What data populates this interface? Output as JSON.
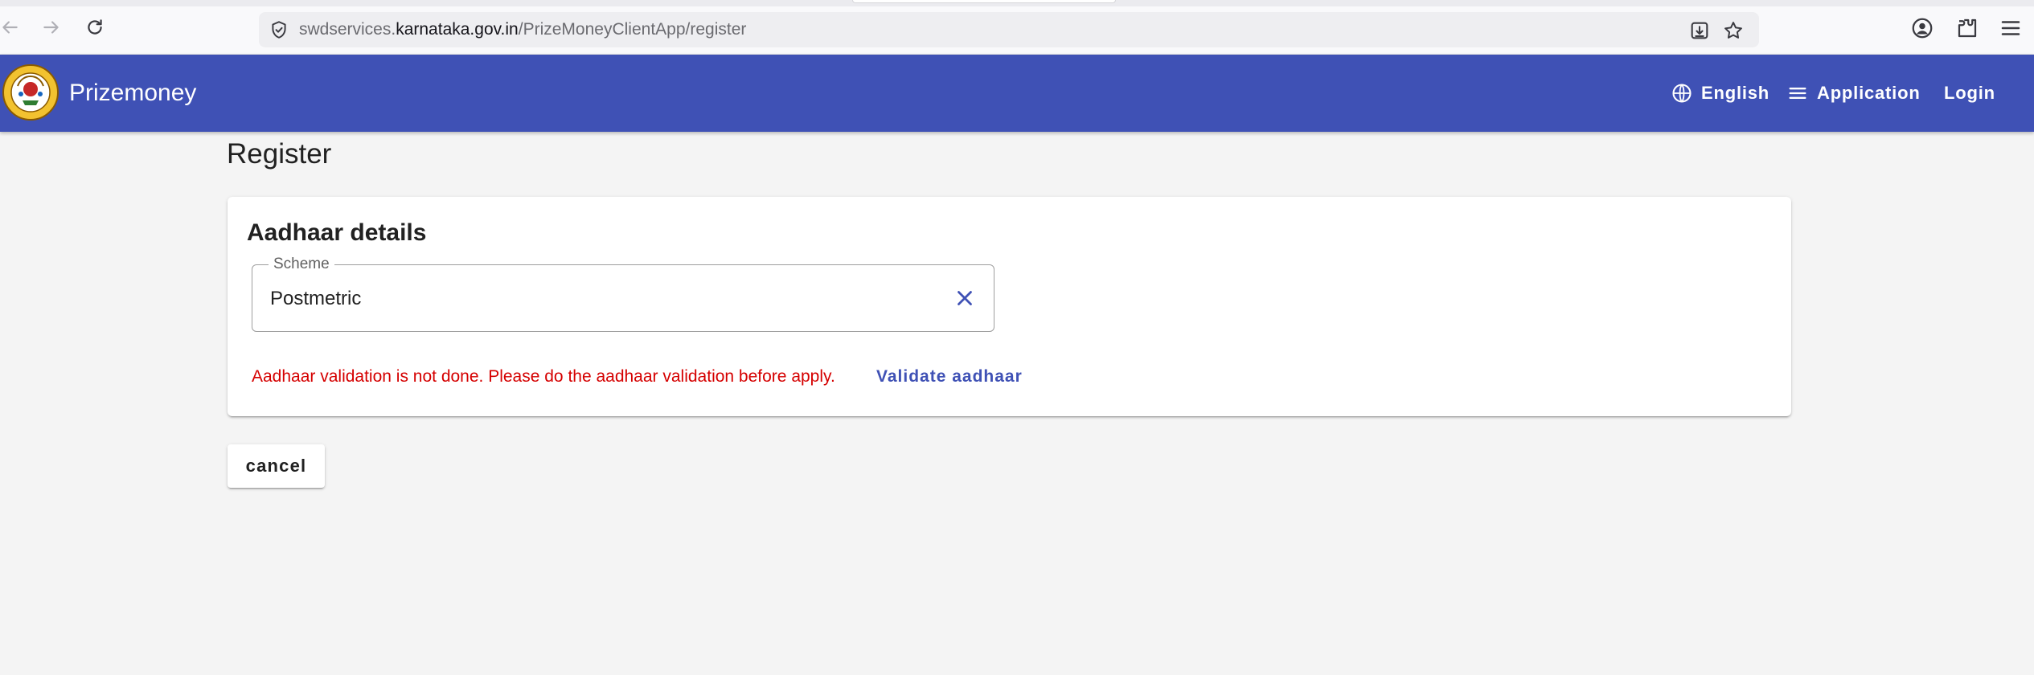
{
  "browser": {
    "url_prefix": "swdservices.",
    "url_domain": "karnataka.gov.in",
    "url_path": "/PrizeMoneyClientApp/register"
  },
  "appbar": {
    "brand": "Prizemoney",
    "language_label": "English",
    "application_label": "Application",
    "login_label": "Login",
    "color": "#3f51b5"
  },
  "page": {
    "title": "Register"
  },
  "card": {
    "title": "Aadhaar details",
    "scheme": {
      "label": "Scheme",
      "value": "Postmetric"
    },
    "error_message": "Aadhaar validation is not done. Please do the aadhaar validation before apply.",
    "validate_label": "Validate aadhaar"
  },
  "actions": {
    "cancel_label": "cancel"
  },
  "colors": {
    "primary": "#3f51b5",
    "error": "#d50000",
    "background": "#f4f4f4"
  }
}
